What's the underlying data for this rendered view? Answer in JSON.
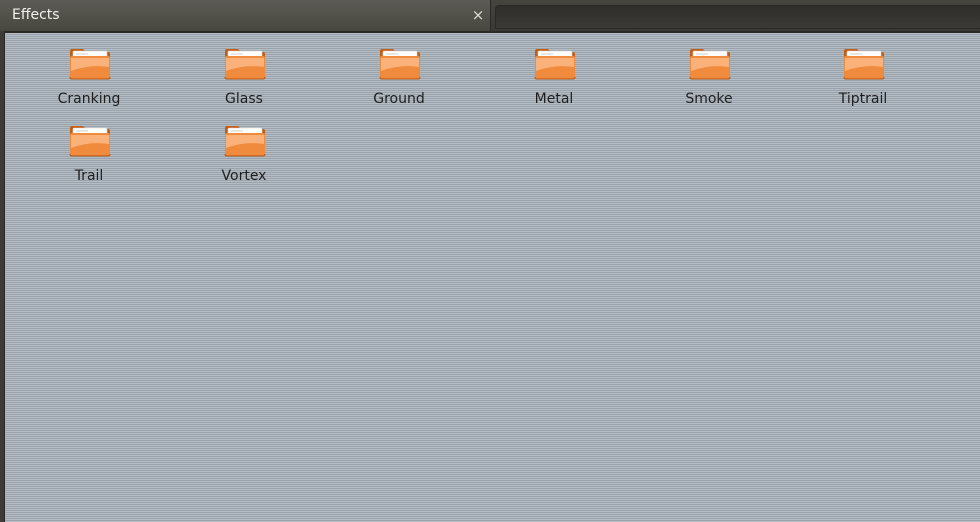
{
  "tab": {
    "title": "Effects",
    "close_glyph": "×"
  },
  "icon": "folder-icon",
  "folders": [
    {
      "label": "Cranking"
    },
    {
      "label": "Glass"
    },
    {
      "label": "Ground"
    },
    {
      "label": "Metal"
    },
    {
      "label": "Smoke"
    },
    {
      "label": "Tiptrail"
    },
    {
      "label": "Trail"
    },
    {
      "label": "Vortex"
    }
  ],
  "colors": {
    "folder_orange": "#f08a3c",
    "folder_light": "#fbb27a",
    "background": "#a9b2bb"
  }
}
